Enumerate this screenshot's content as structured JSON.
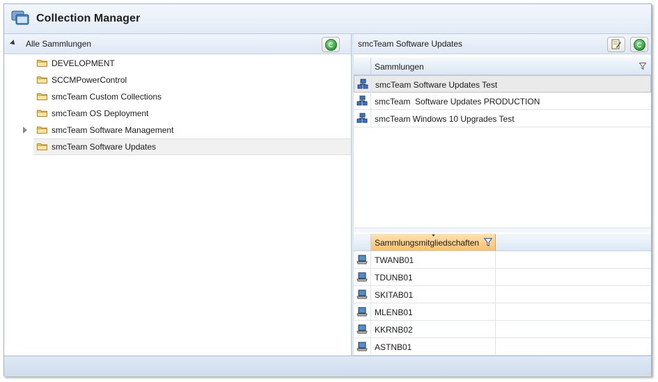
{
  "window": {
    "title": "Collection Manager"
  },
  "left": {
    "header": "Alle Sammlungen",
    "tree": [
      {
        "label": "DEVELOPMENT",
        "expandable": false,
        "selected": false
      },
      {
        "label": "SCCMPowerControl",
        "expandable": false,
        "selected": false
      },
      {
        "label": "smcTeam Custom Collections",
        "expandable": false,
        "selected": false
      },
      {
        "label": "smcTeam OS Deployment",
        "expandable": false,
        "selected": false
      },
      {
        "label": "smcTeam Software Management",
        "expandable": true,
        "selected": false
      },
      {
        "label": "smcTeam Software Updates",
        "expandable": false,
        "selected": true
      }
    ]
  },
  "right": {
    "header": "smcTeam Software Updates",
    "collections": {
      "column": "Sammlungen",
      "rows": [
        "smcTeam Software Updates Test",
        "smcTeam  Software Updates PRODUCTION",
        "smcTeam Windows 10 Upgrades Test"
      ]
    },
    "members": {
      "column": "Sammlungsmitgliedschaften",
      "rows": [
        "TWANB01",
        "TDUNB01",
        "SKITAB01",
        "MLENB01",
        "KKRNB02",
        "ASTNB01"
      ]
    }
  },
  "colors": {
    "accent": "#fbc16a",
    "header": "#dfe8f4",
    "selection": "#eaeaea"
  }
}
